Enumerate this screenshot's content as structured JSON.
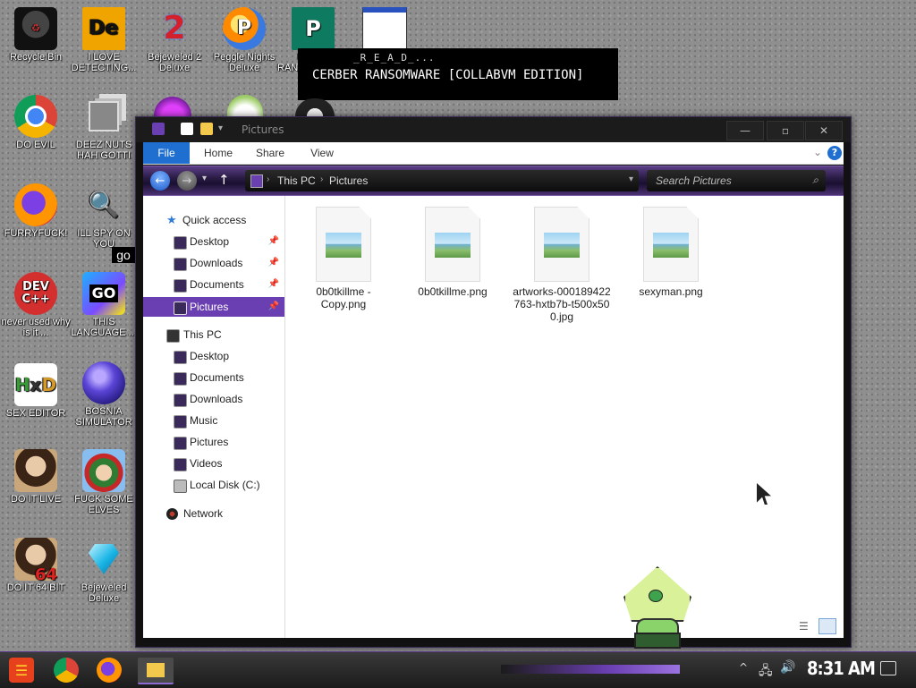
{
  "desktop": {
    "icons": [
      {
        "label": "Recycle Bin"
      },
      {
        "label": "I LOVE DETECTING..."
      },
      {
        "label": "Bejeweled 2 Deluxe"
      },
      {
        "label": "Peggle Nights Deluxe"
      },
      {
        "label": "I LOVE RANSOMWARE"
      },
      {
        "label": "_R_E_A_D_..."
      },
      {
        "label": "DO EVIL"
      },
      {
        "label": "DEEZ NUTS HAH GOTTI"
      },
      {
        "label": "FURRYFUCK!"
      },
      {
        "label": "ILL SPY ON YOU"
      },
      {
        "label": "never used why is it ..."
      },
      {
        "label": "THIS LANGUAGE ..."
      },
      {
        "label": "SEX EDITOR"
      },
      {
        "label": "BOSNIA SIMULATOR"
      },
      {
        "label": "DO IT LIVE"
      },
      {
        "label": "FUCK SOME ELVES"
      },
      {
        "label": "DO IT 64 BIT"
      },
      {
        "label": "Bejeweled Deluxe"
      }
    ],
    "go_badge": "go",
    "ransom_banner": {
      "file_label": "_R_E_A_D_...",
      "text": "CERBER RANSOMWARE [COLLABVM EDITION]"
    }
  },
  "explorer": {
    "title": "Pictures",
    "window_controls": {
      "minimize": "—",
      "maximize": "▫",
      "close": "✕"
    },
    "ribbon_tabs": [
      "File",
      "Home",
      "Share",
      "View"
    ],
    "breadcrumb": [
      "This PC",
      "Pictures"
    ],
    "search_placeholder": "Search Pictures",
    "nav": {
      "quick_access": "Quick access",
      "quick_items": [
        "Desktop",
        "Downloads",
        "Documents",
        "Pictures"
      ],
      "this_pc": "This PC",
      "pc_items": [
        "Desktop",
        "Documents",
        "Downloads",
        "Music",
        "Pictures",
        "Videos",
        "Local Disk (C:)"
      ],
      "network": "Network"
    },
    "files": [
      {
        "name": "0b0tkillme - Copy.png"
      },
      {
        "name": "0b0tkillme.png"
      },
      {
        "name": "artworks-000189422763-hxtb7b-t500x500.jpg"
      },
      {
        "name": "sexyman.png"
      }
    ]
  },
  "taskbar": {
    "clock": "8:31 AM"
  }
}
